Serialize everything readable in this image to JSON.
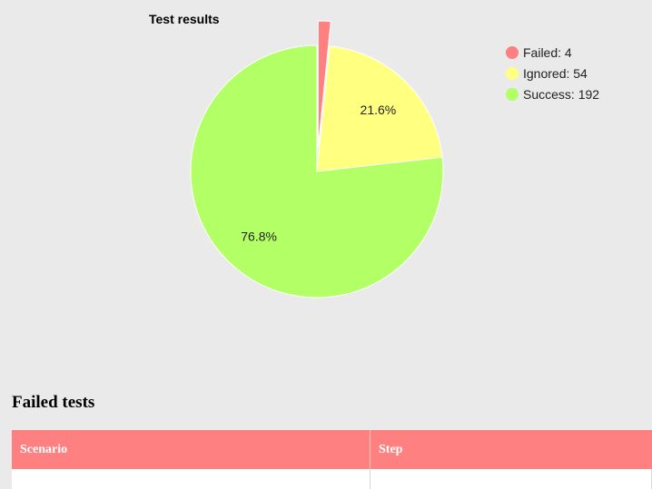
{
  "chart_data": {
    "type": "pie",
    "title": "Test results",
    "slices": [
      {
        "name": "Failed",
        "value": 4,
        "color": "#ff8080",
        "exploded": true,
        "percent_label": ""
      },
      {
        "name": "Ignored",
        "value": 54,
        "color": "#ffff80",
        "exploded": false,
        "percent_label": "21.6%"
      },
      {
        "name": "Success",
        "value": 192,
        "color": "#b3ff66",
        "exploded": false,
        "percent_label": "76.8%"
      }
    ],
    "legend": {
      "placement": "top-right",
      "entries": [
        "Failed: 4",
        "Ignored: 54",
        "Success: 192"
      ]
    }
  },
  "failed_tests": {
    "heading": "Failed tests",
    "columns": [
      "Scenario",
      "Step"
    ]
  }
}
